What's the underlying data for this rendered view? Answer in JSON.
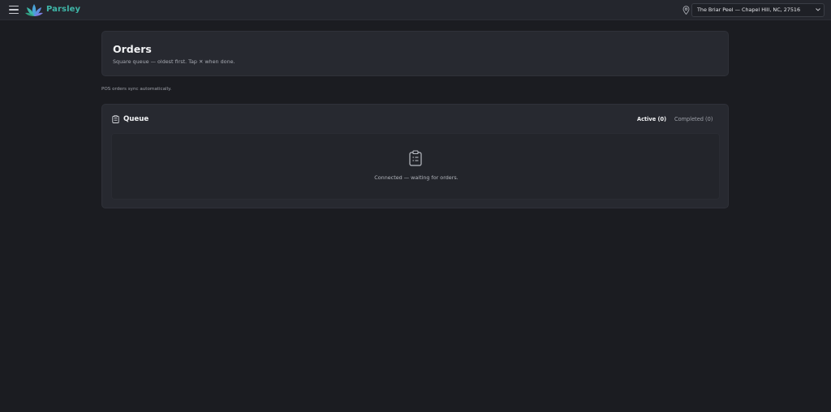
{
  "header": {
    "brand": "Parsley",
    "location": "The Briar Peel — Chapel Hill, NC, 27516",
    "icons": {
      "menu": "hamburger-icon",
      "logo": "parsley-leaf-logo",
      "location": "location-pin-icon",
      "dropdown": "chevron-down-icon"
    }
  },
  "orders": {
    "title": "Orders",
    "subtitle": "Square queue — oldest first. Tap ✕ when done."
  },
  "sync_note": "POS orders sync automatically.",
  "queue": {
    "title": "Queue",
    "tabs": [
      {
        "label": "Active (0)",
        "active": true
      },
      {
        "label": "Completed (0)",
        "active": false
      }
    ],
    "empty_message": "Connected — waiting for orders.",
    "icons": {
      "title": "clipboard-icon",
      "empty": "clipboard-list-icon"
    }
  },
  "colors": {
    "background": "#1b1c21",
    "topbar": "#24262d",
    "card": "#272930",
    "brand": "#3fb6a8",
    "text_primary": "#f1f2f4",
    "text_muted": "#9da0a8"
  }
}
